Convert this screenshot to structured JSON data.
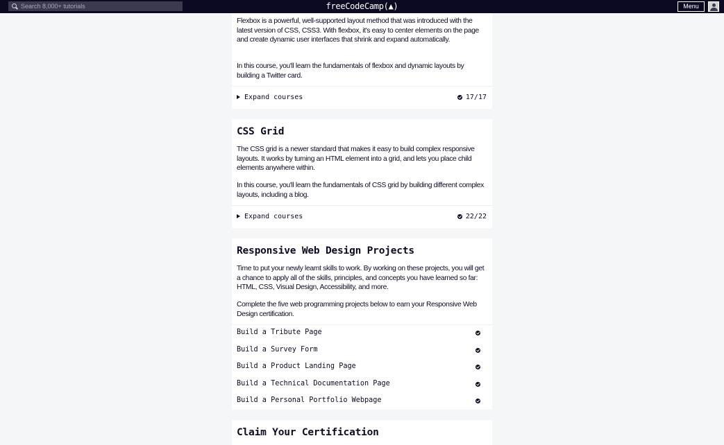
{
  "nav": {
    "search_placeholder": "Search 8,000+ tutorials",
    "logo_text": "freeCodeCamp(",
    "logo_flame": "🔥",
    "logo_end": ")",
    "menu_label": "Menu"
  },
  "flexbox": {
    "paragraphs": [
      "Flexbox is a powerful, well-supported layout method that was introduced with the latest version of CSS, CSS3. With flexbox, it's easy to center elements on the page and create dynamic user interfaces that shrink and expand automatically.",
      "In this course, you'll learn the fundamentals of flexbox and dynamic layouts by building a Twitter card."
    ],
    "expand_label": "Expand courses",
    "progress": "17/17"
  },
  "grid": {
    "title": "CSS Grid",
    "paragraphs": [
      "The CSS grid is a newer standard that makes it easy to build complex responsive layouts. It works by turning an HTML element into a grid, and lets you place child elements anywhere within.",
      "In this course, you'll learn the fundamentals of CSS grid by building different complex layouts, including a blog."
    ],
    "expand_label": "Expand courses",
    "progress": "22/22"
  },
  "projects": {
    "title": "Responsive Web Design Projects",
    "paragraphs": [
      "Time to put your newly learnt skills to work. By working on these projects, you will get a chance to apply all of the skills, principles, and concepts you have learned so far: HTML, CSS, Visual Design, Accessibility, and more.",
      "Complete the five web programming projects below to earn your Responsive Web Design certification."
    ],
    "items": [
      {
        "label": "Build a Tribute Page",
        "completed": true
      },
      {
        "label": "Build a Survey Form",
        "completed": true
      },
      {
        "label": "Build a Product Landing Page",
        "completed": true
      },
      {
        "label": "Build a Technical Documentation Page",
        "completed": true
      },
      {
        "label": "Build a Personal Portfolio Webpage",
        "completed": true
      }
    ]
  },
  "claim": {
    "title": "Claim Your Certification"
  },
  "colors": {
    "nav_bg": "#0a0a23",
    "page_bg": "#f5f6f7",
    "card_bg": "#ffffff",
    "text": "#0a0a23"
  }
}
